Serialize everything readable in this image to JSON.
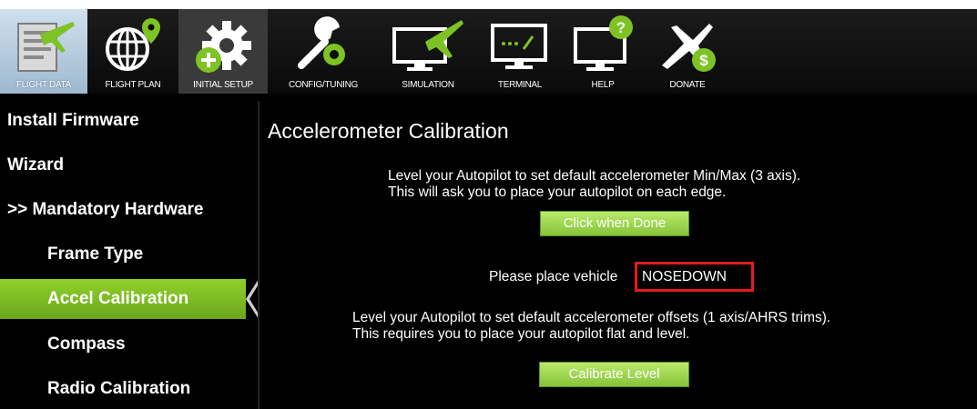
{
  "toolbar": {
    "buttons": [
      {
        "label": "FLIGHT DATA",
        "icon": "flight-data-icon"
      },
      {
        "label": "FLIGHT PLAN",
        "icon": "flight-plan-icon"
      },
      {
        "label": "INITIAL SETUP",
        "icon": "initial-setup-icon"
      },
      {
        "label": "CONFIG/TUNING",
        "icon": "config-tuning-icon"
      },
      {
        "label": "SIMULATION",
        "icon": "simulation-icon"
      },
      {
        "label": "TERMINAL",
        "icon": "terminal-icon"
      },
      {
        "label": "HELP",
        "icon": "help-icon"
      },
      {
        "label": "DONATE",
        "icon": "donate-icon"
      }
    ]
  },
  "sidebar": {
    "items": [
      {
        "label": "Install Firmware",
        "level": 0
      },
      {
        "label": "Wizard",
        "level": 0
      },
      {
        "label": ">> Mandatory Hardware",
        "level": 0
      },
      {
        "label": "Frame Type",
        "level": 1
      },
      {
        "label": "Accel Calibration",
        "level": 1,
        "selected": true
      },
      {
        "label": "Compass",
        "level": 1
      },
      {
        "label": "Radio Calibration",
        "level": 1
      }
    ]
  },
  "main": {
    "title": "Accelerometer Calibration",
    "accel_3axis": {
      "line1": "Level your Autopilot to set default accelerometer Min/Max (3 axis).",
      "line2": "This will ask you to place your autopilot on each edge.",
      "button": "Click when Done"
    },
    "status": {
      "prefix": "Please place vehicle",
      "value": "NOSEDOWN"
    },
    "level": {
      "line1": "Level your Autopilot to set default accelerometer offsets (1 axis/AHRS trims).",
      "line2": "This requires you to place your autopilot flat and level.",
      "button": "Calibrate Level"
    }
  },
  "colors": {
    "accent_green": "#86c43a",
    "highlight_red": "#e21b23",
    "background": "#000000",
    "active_tab": "#b8cfe2"
  }
}
